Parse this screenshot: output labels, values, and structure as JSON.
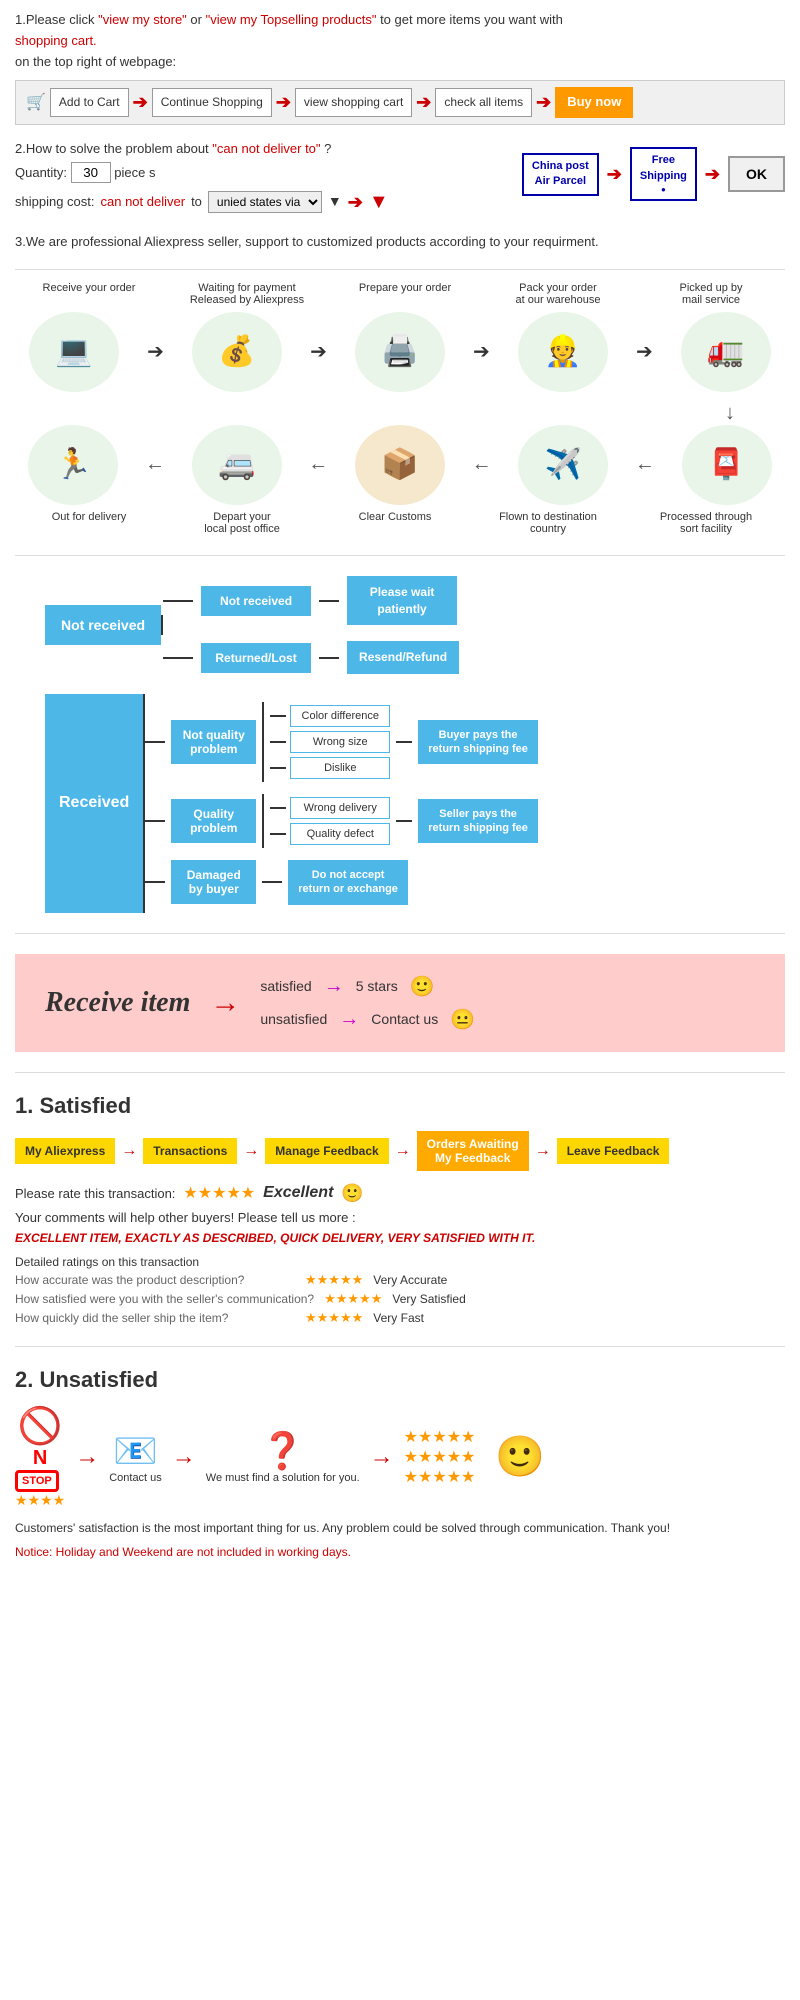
{
  "section1": {
    "text1": "1.Please click ",
    "link1": "\"view my store\"",
    "text2": "or ",
    "link2": "\"view my Topselling products\"",
    "text3": " to get more items you want with",
    "link3": "shopping cart.",
    "text4": "on the top right of webpage:",
    "steps": [
      {
        "label": "Add to Cart"
      },
      {
        "label": "Continue Shopping"
      },
      {
        "label": "view shopping cart"
      },
      {
        "label": "check all items"
      },
      {
        "label": "Buy now"
      }
    ]
  },
  "section2": {
    "header": "2.How to solve the problem about",
    "problem": "\"can not deliver to\"",
    "suffix": "?",
    "qty_label": "Quantity:",
    "qty_value": "30",
    "qty_suffix": "piece s",
    "shipping_label": "shipping cost:",
    "cannot_deliver": "can not deliver",
    "to_text": " to ",
    "dropdown_value": "unied states via",
    "china_post_line1": "China post",
    "china_post_line2": "Air Parcel",
    "free_shipping_line1": "Free",
    "free_shipping_line2": "Shipping",
    "free_shipping_dot": "●",
    "ok_btn": "OK"
  },
  "section3": {
    "text": "3.We are professional Aliexpress seller, support to customized products according to your requirment."
  },
  "process": {
    "top_labels": [
      "Receive your order",
      "Waiting for payment\nReleased by Aliexpress",
      "Prepare your order",
      "Pack your order\nat our warehouse",
      "Picked up by\nmail service"
    ],
    "top_icons": [
      "💻",
      "💰",
      "🖨️",
      "👷",
      "🚛"
    ],
    "bottom_labels": [
      "Out for delivery",
      "Depart your\nlocal post office",
      "Clear Customs",
      "Flown to destination\ncountry",
      "Processed through\nsort facility"
    ],
    "bottom_icons": [
      "🏃",
      "🚐",
      "📦",
      "✈️",
      "📮"
    ]
  },
  "not_received": {
    "left_label": "Not received",
    "branch1": "Not received",
    "result1_line1": "Please wait",
    "result1_line2": "patiently",
    "branch2": "Returned/Lost",
    "result2": "Resend/Refund"
  },
  "received": {
    "left_label": "Received",
    "branch1": "Not quality\nproblem",
    "branch1_subs": [
      "Color difference",
      "Wrong size",
      "Dislike"
    ],
    "branch1_result_line1": "Buyer pays the",
    "branch1_result_line2": "return shipping fee",
    "branch2": "Quality\nproblem",
    "branch2_subs": [
      "Wrong delivery",
      "Quality defect"
    ],
    "branch2_result_line1": "Seller pays the",
    "branch2_result_line2": "return shipping fee",
    "branch3": "Damaged\nby buyer",
    "branch3_result": "Do not accept\nreturn or exchange"
  },
  "pink_section": {
    "receive_item": "Receive item",
    "arrow": "→",
    "row1_text": "satisfied",
    "row1_arrow": "→",
    "row1_result": "5 stars",
    "row1_emoji": "🙂",
    "row2_text": "unsatisfied",
    "row2_arrow": "→",
    "row2_result": "Contact us",
    "row2_emoji": "😐"
  },
  "satisfied": {
    "number": "1.",
    "title": "Satisfied",
    "steps": [
      "My Aliexpress",
      "Transactions",
      "Manage Feedback",
      "Orders Awaiting\nMy Feedback",
      "Leave Feedback"
    ],
    "rate_label": "Please rate this transaction:",
    "stars": "★★★★★",
    "excellent_label": "Excellent",
    "emoji": "🙂",
    "comment_help": "Your comments will help other buyers! Please tell us more :",
    "excellent_comment": "EXCELLENT ITEM, EXACTLY AS DESCRIBED, QUICK DELIVERY, VERY SATISFIED WITH IT.",
    "detail_title": "Detailed ratings on this transaction",
    "detail_rows": [
      {
        "label": "How accurate was the product description?",
        "stars": "★★★★★",
        "result": "Very Accurate"
      },
      {
        "label": "How satisfied were you with the seller's communication?",
        "stars": "★★★★★",
        "result": "Very Satisfied"
      },
      {
        "label": "How quickly did the seller ship the item?",
        "stars": "★★★★★",
        "result": "Very Fast"
      }
    ]
  },
  "unsatisfied": {
    "number": "2.",
    "title": "Unsatisfied",
    "steps": [
      {
        "icon": "🚫",
        "extra": "N\n⭐⭐⭐⭐"
      },
      {
        "icon": "📧",
        "label": "Contact us"
      },
      {
        "icon": "❓",
        "label": "We must find\na solution for\nyou."
      },
      {
        "icon": "stars3rows"
      }
    ],
    "emoji": "🙂"
  },
  "footer": {
    "notice1": "Customers' satisfaction is the most important thing for us. Any problem could be solved through communication. Thank you!",
    "notice2": "Notice: Holiday and Weekend are not included in working days."
  }
}
